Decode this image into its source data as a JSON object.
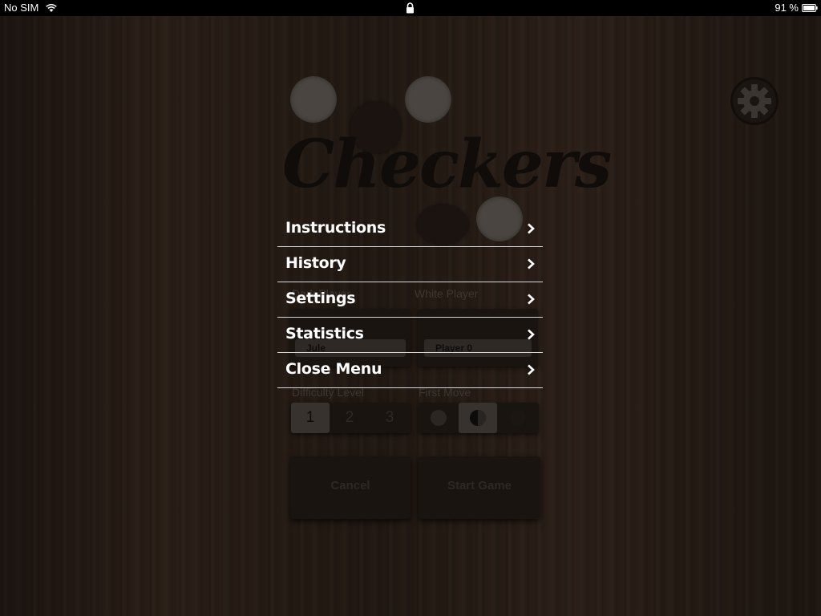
{
  "status_bar": {
    "carrier": "No SIM",
    "battery_percent": "91 %",
    "icons": [
      "wifi-icon",
      "lock-icon",
      "battery-icon"
    ]
  },
  "background_game": {
    "logo": "Checkers",
    "dark_player_label": "Dark Player",
    "white_player_label": "White Player",
    "dark_player_value": "Jule",
    "white_player_value": "Player 0",
    "difficulty_label": "Difficulty Level",
    "difficulty_options": [
      "1",
      "2",
      "3"
    ],
    "difficulty_selected": "1",
    "first_move_label": "First Move",
    "first_move_options": [
      "dark",
      "random",
      "white"
    ],
    "first_move_selected": "random",
    "cancel_label": "Cancel",
    "start_label": "Start Game"
  },
  "menu": {
    "items": [
      {
        "label": "Instructions"
      },
      {
        "label": "History"
      },
      {
        "label": "Settings"
      },
      {
        "label": "Statistics"
      },
      {
        "label": "Close Menu"
      }
    ]
  },
  "colors": {
    "overlay_text": "#ffffff",
    "divider": "#d8d8d8",
    "wood_dark": "#1c1410"
  }
}
